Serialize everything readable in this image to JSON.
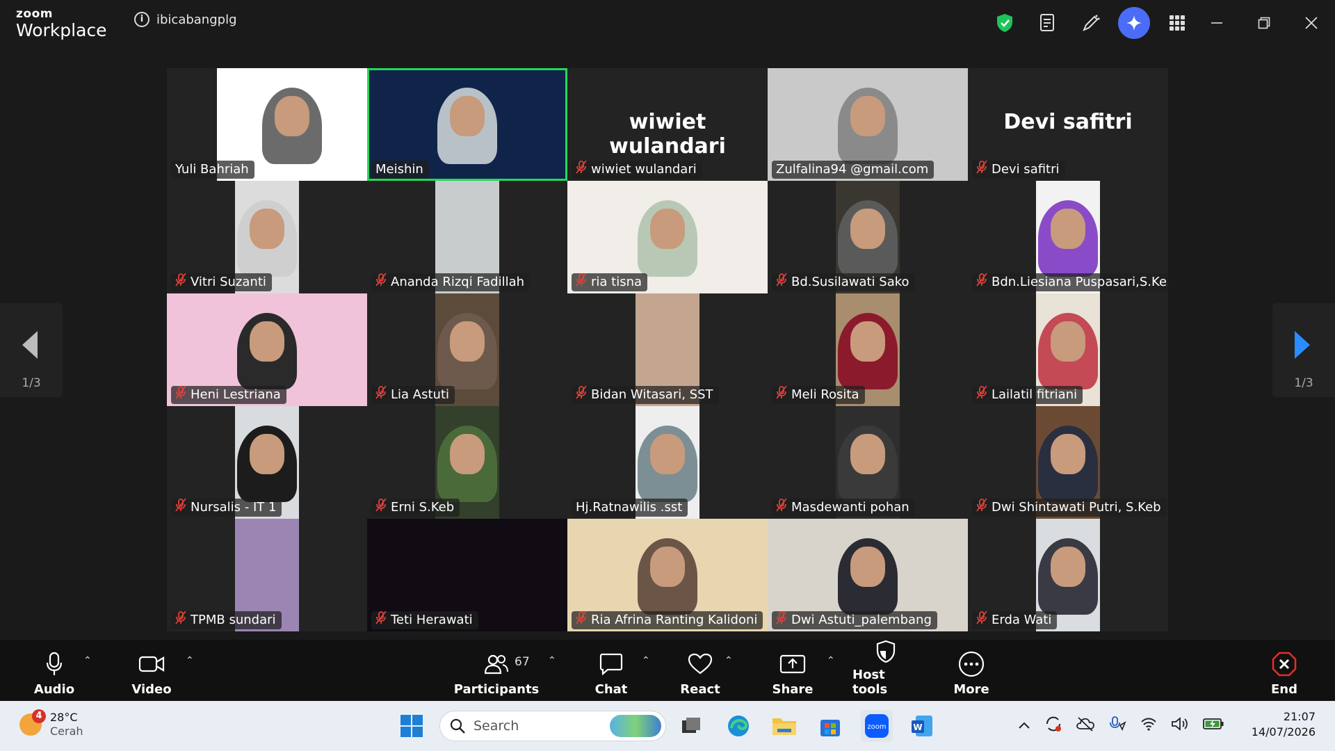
{
  "window": {
    "brand_small": "zoom",
    "brand_big": "Workplace",
    "meeting_name": "ibicabangplg"
  },
  "stage": {
    "page_left": "1/3",
    "page_right": "1/3",
    "tiles": [
      {
        "name": "Yuli Bahriah",
        "muted": false,
        "kind": "video",
        "bg": "#ffffff",
        "hijab": "#6b6b6b"
      },
      {
        "name": "Meishin",
        "muted": false,
        "kind": "video",
        "bg": "#10244a",
        "hijab": "#b9c1c8",
        "active": true
      },
      {
        "name": "wiwiet wulandari",
        "muted": true,
        "kind": "name",
        "display": "wiwiet wulandari"
      },
      {
        "name": "Zulfalina94 @gmail.com",
        "muted": false,
        "kind": "video",
        "bg": "#c9c9c9",
        "hijab": "#8a8a8a"
      },
      {
        "name": "Devi safitri",
        "muted": true,
        "kind": "name",
        "display": "Devi safitri"
      },
      {
        "name": "Vitri Suzanti",
        "muted": true,
        "kind": "video",
        "bg": "#dcdcdc",
        "hijab": "#cfcfcf"
      },
      {
        "name": "Ananda Rizqi Fadillah",
        "muted": true,
        "kind": "video",
        "bg": "#c8cccc",
        "hijab": null
      },
      {
        "name": "ria tisna",
        "muted": true,
        "kind": "video",
        "bg": "#f1ede8",
        "hijab": "#b8c8b5"
      },
      {
        "name": "Bd.Susilawati Sako",
        "muted": true,
        "kind": "video",
        "bg": "#3a3630",
        "hijab": "#5a5a5a"
      },
      {
        "name": "Bdn.Liesiana Puspasari,S.Ke...",
        "muted": true,
        "kind": "video",
        "bg": "#f2f2f2",
        "hijab": "#8a4bc8"
      },
      {
        "name": "Heni Lestriana",
        "muted": true,
        "kind": "video",
        "bg": "#f0c3da",
        "hijab": "#2a2a2a"
      },
      {
        "name": "Lia Astuti",
        "muted": true,
        "kind": "video",
        "bg": "#5c4a3a",
        "hijab": "#6d5a4d"
      },
      {
        "name": "Bidan Witasari, SST",
        "muted": true,
        "kind": "video",
        "bg": "#c4a690",
        "hijab": null
      },
      {
        "name": "Meli Rosita",
        "muted": true,
        "kind": "video",
        "bg": "#a88e6e",
        "hijab": "#8b1a2c"
      },
      {
        "name": "Lailatil fitriani",
        "muted": true,
        "kind": "video",
        "bg": "#e9e2d6",
        "hijab": "#c44a55"
      },
      {
        "name": "Nursalis - IT 1",
        "muted": true,
        "kind": "video",
        "bg": "#d9dcdf",
        "hijab": "#1c1c1c"
      },
      {
        "name": "Erni S.Keb",
        "muted": true,
        "kind": "video",
        "bg": "#32402c",
        "hijab": "#4b6a3a"
      },
      {
        "name": "Hj.Ratnawilis .sst",
        "muted": false,
        "kind": "video",
        "bg": "#eeeeee",
        "hijab": "#7c8f94"
      },
      {
        "name": "Masdewanti pohan",
        "muted": true,
        "kind": "video",
        "bg": "#2e2e2e",
        "hijab": "#3a3a3a"
      },
      {
        "name": "Dwi Shintawati Putri, S.Keb",
        "muted": true,
        "kind": "video",
        "bg": "#6b4a34",
        "hijab": "#2a2f3f"
      },
      {
        "name": "TPMB sundari",
        "muted": true,
        "kind": "video",
        "bg": "#9b86b3",
        "hijab": null
      },
      {
        "name": "Teti Herawati",
        "muted": true,
        "kind": "video",
        "bg": "#110b14",
        "hijab": null
      },
      {
        "name": "Ria Afrina Ranting Kalidoni",
        "muted": true,
        "kind": "video",
        "bg": "#e7d6b0",
        "hijab": "#6a5546"
      },
      {
        "name": "Dwi Astuti_palembang",
        "muted": true,
        "kind": "video",
        "bg": "#d8d4cc",
        "hijab": "#2b2b33"
      },
      {
        "name": "Erda Wati",
        "muted": true,
        "kind": "video",
        "bg": "#d9dde0",
        "hijab": "#3a3a44"
      }
    ]
  },
  "toolbar": {
    "audio": "Audio",
    "video": "Video",
    "participants": "Participants",
    "participants_count": "67",
    "chat": "Chat",
    "react": "React",
    "share": "Share",
    "host_tools": "Host tools",
    "more": "More",
    "end": "End"
  },
  "taskbar": {
    "weather_badge": "4",
    "temperature": "28°C",
    "condition": "Cerah",
    "search_placeholder": "Search",
    "time": "21:07",
    "date": "14/07/2026"
  },
  "colors": {
    "active_speaker": "#23d959",
    "muted_icon": "#e0413a",
    "end_button": "#e02e2a",
    "ai_button": "#4a6cf7"
  }
}
